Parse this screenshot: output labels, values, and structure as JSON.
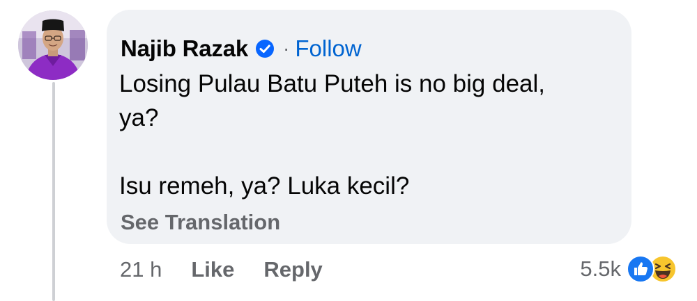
{
  "comment": {
    "author": "Najib Razak",
    "separator": "·",
    "follow_label": "Follow",
    "text_lines": [
      "Losing Pulau Batu Puteh is no big deal,",
      "ya?",
      "Isu remeh, ya? Luka kecil?"
    ],
    "see_translation_label": "See Translation"
  },
  "actions": {
    "timestamp": "21 h",
    "like_label": "Like",
    "reply_label": "Reply"
  },
  "reactions": {
    "count": "5.5k",
    "icons": [
      "like-icon",
      "haha-icon"
    ]
  },
  "colors": {
    "bubble_bg": "#f0f2f5",
    "link_blue": "#0064d1",
    "verified_blue": "#0866ff",
    "secondary_text": "#65676b",
    "thread_line": "#ced0d4"
  }
}
